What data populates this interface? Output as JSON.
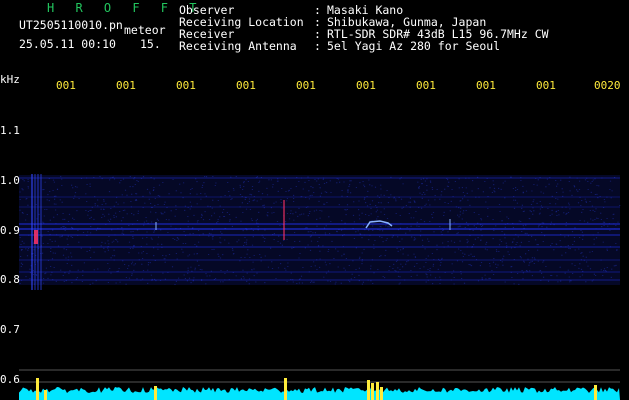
{
  "header": {
    "brand": "H R O F F T",
    "filename": "UT2505110010.pn",
    "event_type": "meteor",
    "datetime": "25.05.11 00:10",
    "interval": "15.",
    "labels": [
      "Observer",
      "Receiving Location",
      "Receiver",
      "Receiving Antenna"
    ],
    "colons": [
      ":",
      ":",
      ":",
      ":"
    ],
    "values": [
      "Masaki Kano",
      "Shibukawa, Gunma, Japan",
      "RTL-SDR SDR# 43dB L15 96.7MHz CW",
      "5el Yagi Az 280 for Seoul"
    ]
  },
  "axis": {
    "y_unit": "kHz",
    "y_ticks": [
      "1.1",
      "1.0",
      "0.9",
      "0.8",
      "0.7",
      "0.6"
    ],
    "x_ticks": [
      "001",
      "001",
      "001",
      "001",
      "001",
      "001",
      "001",
      "001",
      "001",
      "0020"
    ]
  },
  "colors": {
    "background": "#000000",
    "brand": "#22c55e",
    "x_tick": "#ffeb3b",
    "signal": "#2233ff",
    "power_trace": "#00e5ff",
    "power_spike": "#ffeb3b"
  }
}
